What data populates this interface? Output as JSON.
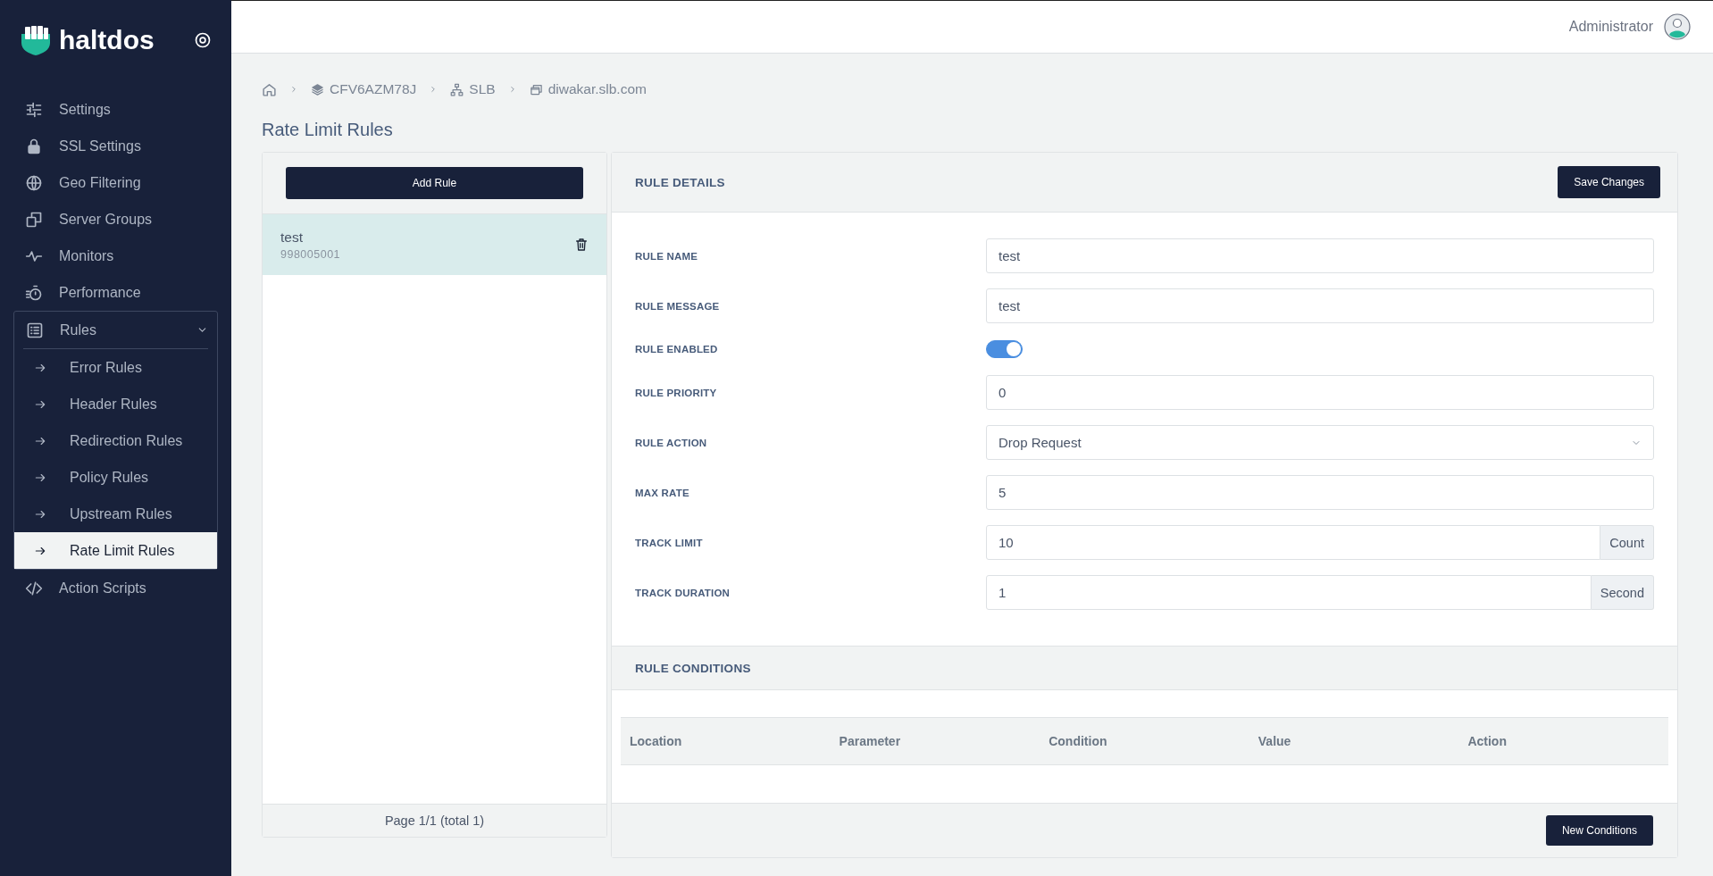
{
  "brand": {
    "name": "haltdos"
  },
  "sidebar": {
    "items": [
      {
        "label": "Settings",
        "selected": false
      },
      {
        "label": "SSL Settings",
        "selected": false
      },
      {
        "label": "Geo Filtering",
        "selected": false
      },
      {
        "label": "Server Groups",
        "selected": false
      },
      {
        "label": "Monitors",
        "selected": false
      },
      {
        "label": "Performance",
        "selected": false
      },
      {
        "label": "Rules",
        "selected": false,
        "expanded": true,
        "children": [
          {
            "label": "Error Rules",
            "selected": false
          },
          {
            "label": "Header Rules",
            "selected": false
          },
          {
            "label": "Redirection Rules",
            "selected": false
          },
          {
            "label": "Policy Rules",
            "selected": false
          },
          {
            "label": "Upstream Rules",
            "selected": false
          },
          {
            "label": "Rate Limit Rules",
            "selected": true
          }
        ]
      },
      {
        "label": "Action Scripts",
        "selected": false
      }
    ]
  },
  "topbar": {
    "user": "Administrator"
  },
  "breadcrumb": [
    "CFV6AZM78J",
    "SLB",
    "diwakar.slb.com"
  ],
  "page_title": "Rate Limit Rules",
  "rules_list": {
    "add_button": "Add Rule",
    "items": [
      {
        "name": "test",
        "id": "998005001",
        "selected": true
      }
    ],
    "pagination": "Page 1/1 (total 1)"
  },
  "rule_details": {
    "title": "RULE DETAILS",
    "save_button": "Save Changes",
    "fields": [
      {
        "label": "RULE NAME",
        "kind": "text",
        "value": "test"
      },
      {
        "label": "RULE MESSAGE",
        "kind": "text",
        "value": "test"
      },
      {
        "label": "RULE ENABLED",
        "kind": "toggle",
        "on": true
      },
      {
        "label": "RULE PRIORITY",
        "kind": "text",
        "value": "0"
      },
      {
        "label": "RULE ACTION",
        "kind": "select",
        "value": "Drop Request"
      },
      {
        "label": "MAX RATE",
        "kind": "text",
        "value": "5"
      },
      {
        "label": "TRACK LIMIT",
        "kind": "addon",
        "value": "10",
        "addon": "Count"
      },
      {
        "label": "TRACK DURATION",
        "kind": "addon",
        "value": "1",
        "addon": "Second"
      }
    ]
  },
  "rule_conditions": {
    "title": "RULE CONDITIONS",
    "columns": [
      "Location",
      "Parameter",
      "Condition",
      "Value",
      "Action"
    ],
    "button": "New Conditions"
  }
}
